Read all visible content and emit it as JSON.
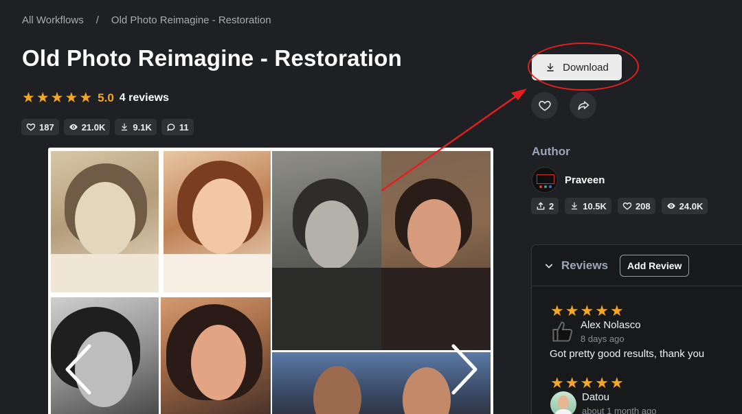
{
  "breadcrumb": {
    "root": "All Workflows",
    "separator": "/",
    "current": "Old Photo Reimagine - Restoration"
  },
  "title": "Old Photo Reimagine - Restoration",
  "rating": {
    "stars": 5,
    "score": "5.0",
    "reviews_label": "4 reviews"
  },
  "stats": {
    "likes": "187",
    "views": "21.0K",
    "downloads": "9.1K",
    "comments": "11"
  },
  "actions": {
    "download_label": "Download"
  },
  "author": {
    "heading": "Author",
    "name": "Praveen",
    "stats": {
      "uploads": "2",
      "downloads": "10.5K",
      "likes": "208",
      "views": "24.0K"
    }
  },
  "reviews": {
    "heading": "Reviews",
    "add_label": "Add Review",
    "items": [
      {
        "stars": 5,
        "name": "Alex Nolasco",
        "time": "8 days ago",
        "text": "Got pretty good results, thank you"
      },
      {
        "stars": 5,
        "name": "Datou",
        "time": "about 1 month ago",
        "text": ""
      }
    ]
  },
  "colors": {
    "background": "#1f2023",
    "star": "#f5a623",
    "annotation": "#e32020",
    "muted_heading": "#9ba6bc"
  }
}
